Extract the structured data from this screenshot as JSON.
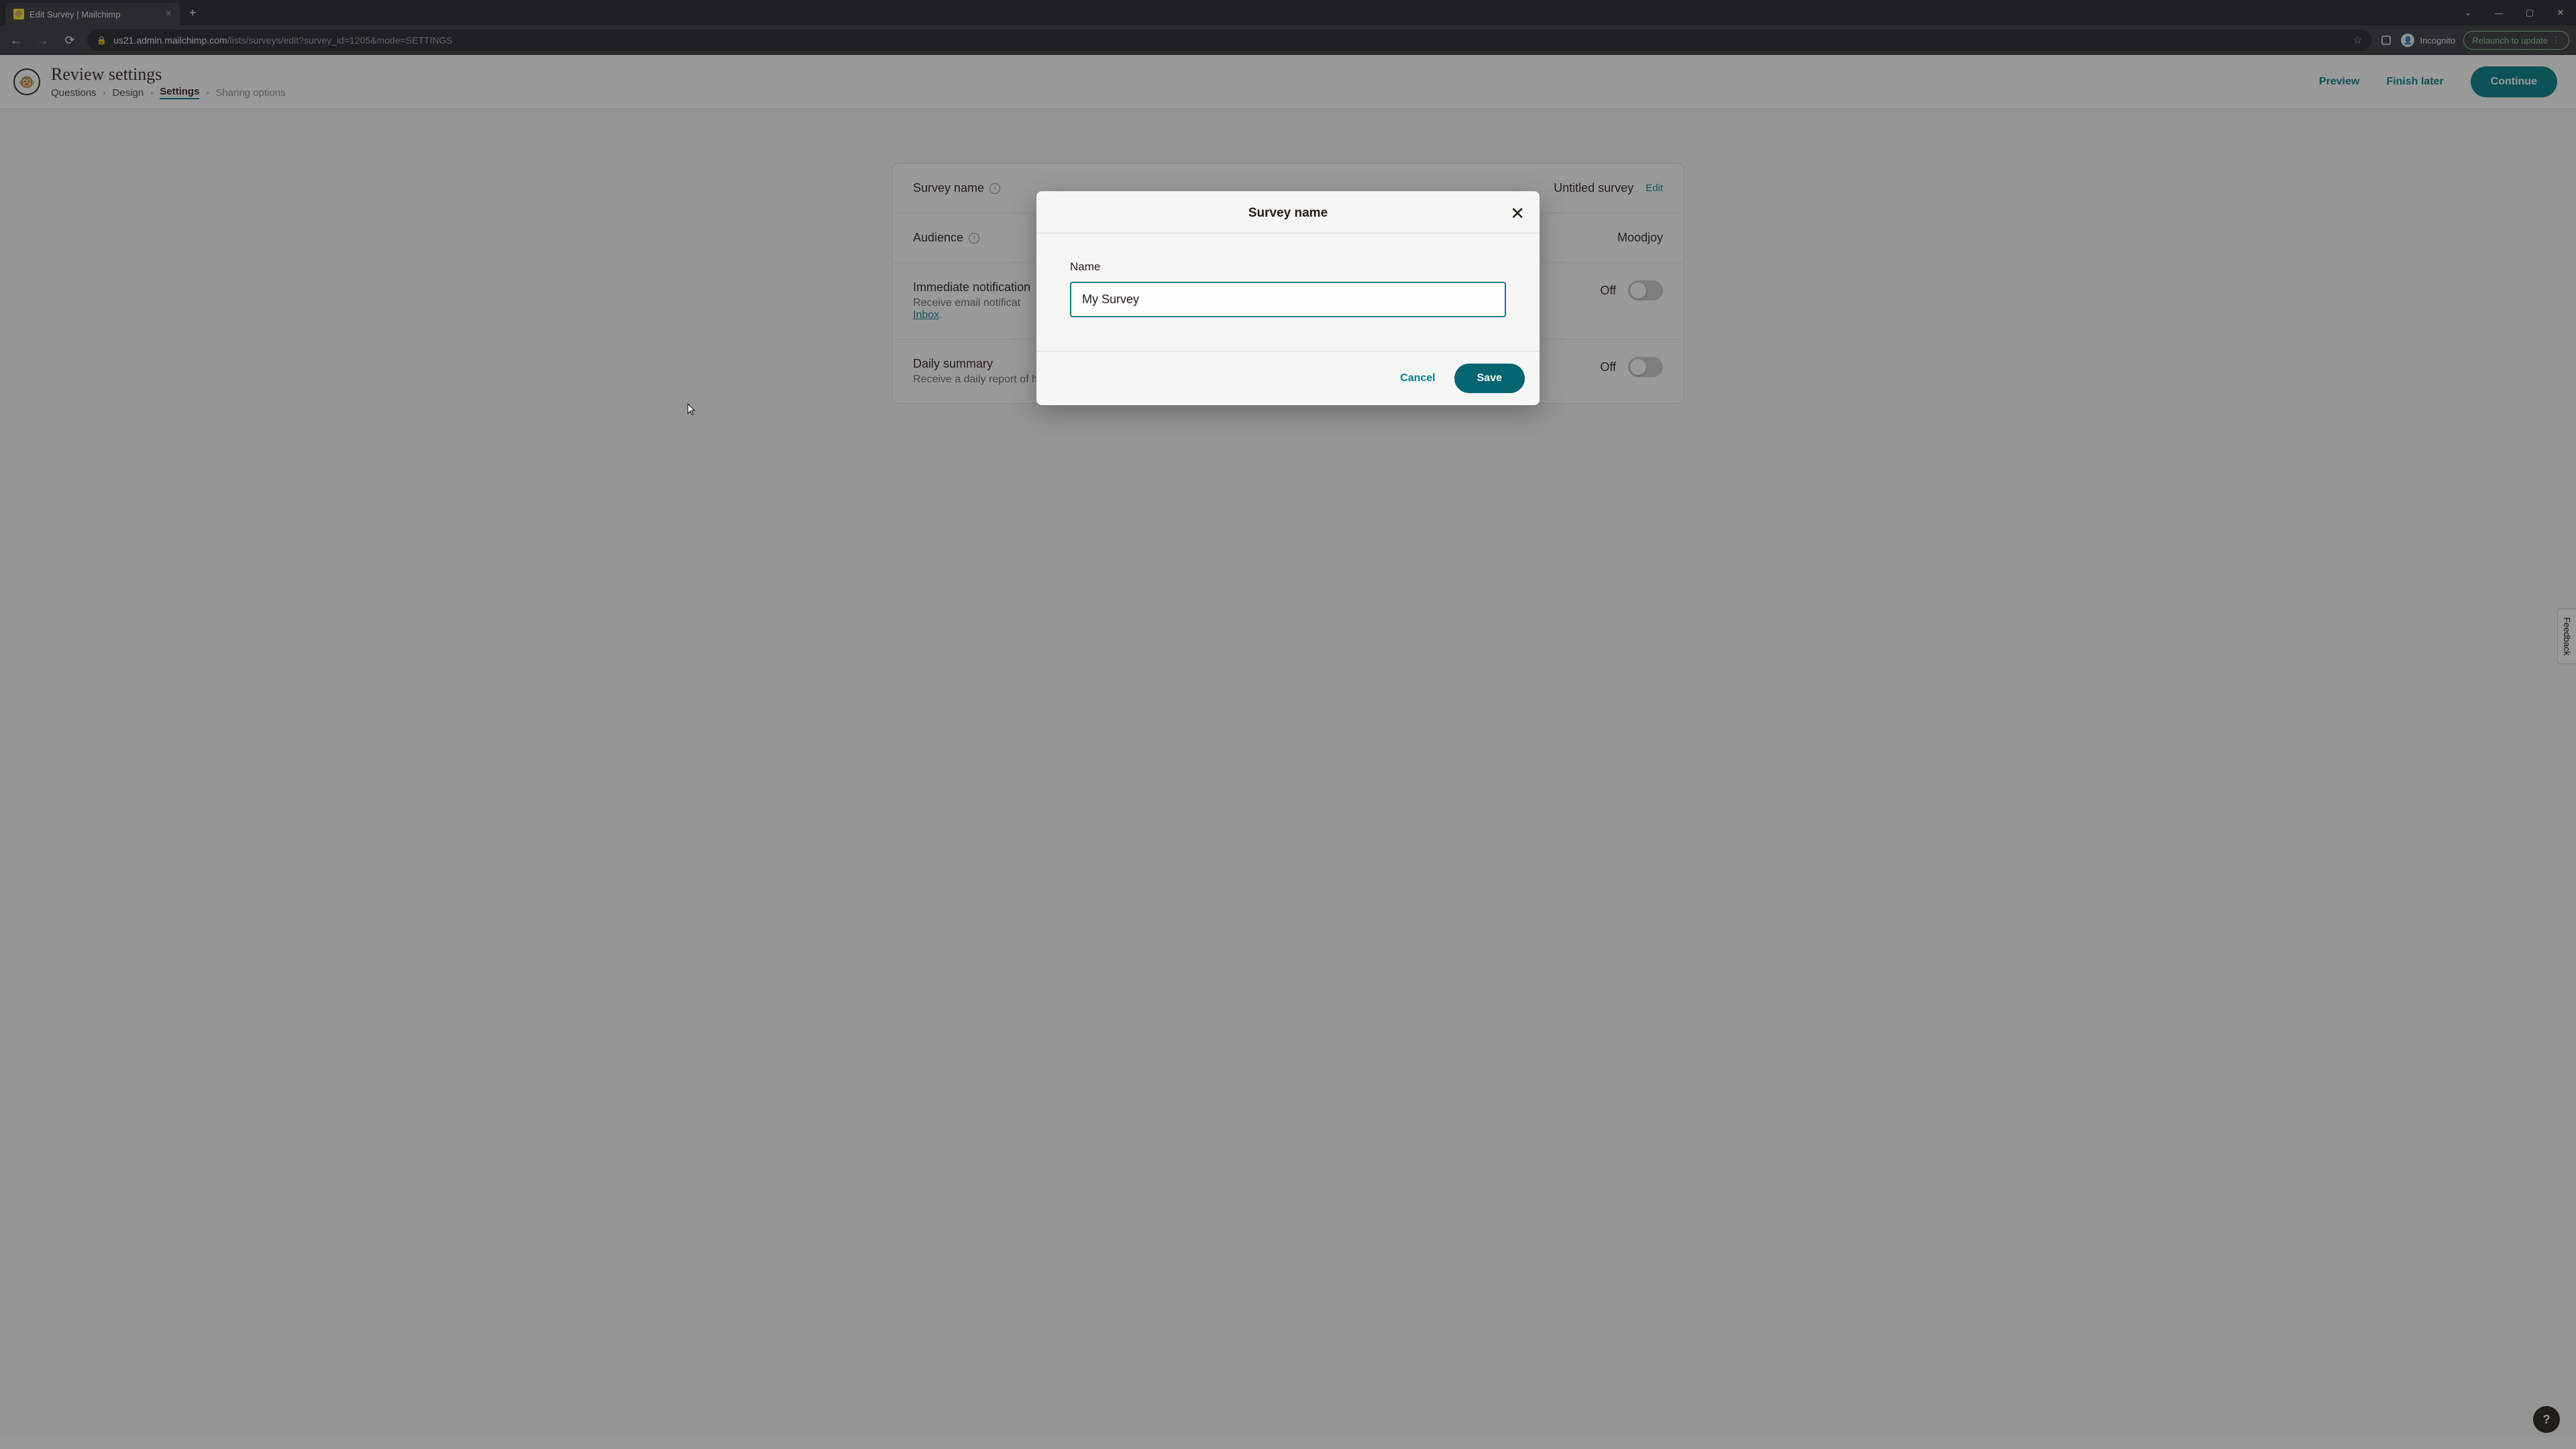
{
  "browser": {
    "tab_title": "Edit Survey | Mailchimp",
    "url_domain": "us21.admin.mailchimp.com",
    "url_path": "/lists/surveys/edit?survey_id=1205&mode=SETTINGS",
    "incognito_label": "Incognito",
    "relaunch_label": "Relaunch to update"
  },
  "header": {
    "title": "Review settings",
    "breadcrumb": [
      "Questions",
      "Design",
      "Settings",
      "Sharing options"
    ],
    "active_crumb_index": 2,
    "preview_label": "Preview",
    "finish_label": "Finish later",
    "continue_label": "Continue"
  },
  "settings": {
    "survey_name": {
      "label": "Survey name",
      "value": "Untitled survey",
      "edit_label": "Edit"
    },
    "audience": {
      "label": "Audience",
      "value": "Moodjoy"
    },
    "notifications": {
      "label": "Immediate notification",
      "desc_prefix": "Receive email notificat",
      "inbox_link": "Inbox",
      "toggle_state": "Off"
    },
    "summary": {
      "label": "Daily summary",
      "desc": "Receive a daily report of how many new survey responses were collected.",
      "toggle_state": "Off"
    }
  },
  "modal": {
    "title": "Survey name",
    "field_label": "Name",
    "input_value": "My Survey",
    "cancel_label": "Cancel",
    "save_label": "Save"
  },
  "feedback_label": "Feedback"
}
